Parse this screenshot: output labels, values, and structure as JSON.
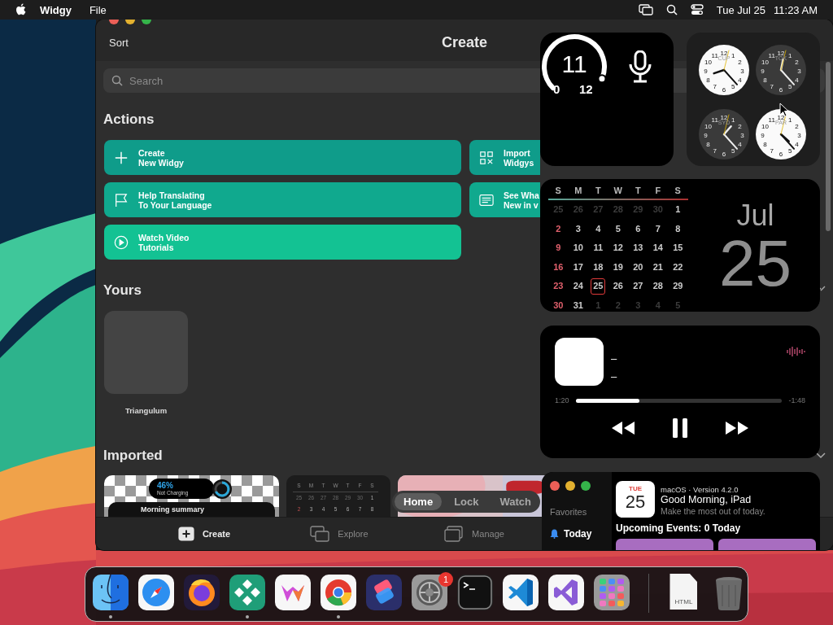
{
  "menu_bar": {
    "app": "Widgy",
    "menus": [
      "File"
    ],
    "date": "Tue Jul 25",
    "time": "11:23 AM"
  },
  "window": {
    "title": "Create",
    "sort_label": "Sort",
    "search": {
      "placeholder": "Search"
    }
  },
  "actions": {
    "heading": "Actions",
    "buttons": [
      {
        "lines": [
          "Create",
          "New Widgy"
        ]
      },
      {
        "lines": [
          "Import",
          "Widgys"
        ]
      },
      {
        "lines": [
          "Help Translating",
          "To Your Language"
        ]
      },
      {
        "lines": [
          "See Wha",
          "New in v"
        ]
      },
      {
        "lines": [
          "Watch Video",
          "Tutorials"
        ]
      }
    ]
  },
  "yours": {
    "heading": "Yours",
    "items": [
      {
        "name": "Triangulum"
      }
    ]
  },
  "imported": {
    "heading": "Imported",
    "items": [
      {
        "kind": "battery",
        "percent": "46%",
        "status": "Not Charging",
        "caption": "Morning summary"
      },
      {
        "kind": "calendar",
        "weekdays": [
          "S",
          "M",
          "T",
          "W",
          "T",
          "F",
          "S"
        ],
        "rows": [
          [
            "25",
            "26",
            "27",
            "28",
            "29",
            "30",
            "1"
          ],
          [
            "2",
            "3",
            "4",
            "5",
            "6",
            "7",
            "8"
          ]
        ]
      },
      {
        "kind": "picture"
      }
    ]
  },
  "view_switch": [
    {
      "label": "Home",
      "selected": true
    },
    {
      "label": "Lock",
      "selected": false
    },
    {
      "label": "Watch",
      "selected": false
    }
  ],
  "tab_bar": [
    {
      "label": "Create",
      "selected": true
    },
    {
      "label": "Explore",
      "selected": false
    },
    {
      "label": "Manage",
      "selected": false
    }
  ],
  "gauge_widget": {
    "value": "11",
    "min": "0",
    "max": "12"
  },
  "world_clock": {
    "clocks": [
      {
        "city": "CUP",
        "kind": "light",
        "numerals": [
          "12",
          "11",
          "1",
          "10",
          "2",
          "9",
          "3",
          "8",
          "4",
          "7",
          "5",
          "6"
        ]
      },
      {
        "city": "TOK",
        "kind": "dark",
        "numerals": [
          "12",
          "11",
          "1",
          "10",
          "2",
          "9",
          "3",
          "8",
          "4",
          "7",
          "5",
          "6"
        ]
      },
      {
        "city": "SYD",
        "kind": "dark",
        "numerals": [
          "12",
          "11",
          "1",
          "10",
          "2",
          "9",
          "3",
          "8",
          "4",
          "7",
          "5",
          "6"
        ]
      },
      {
        "city": "PAR",
        "kind": "light",
        "numerals": [
          "12",
          "11",
          "1",
          "10",
          "2",
          "9",
          "3",
          "8",
          "4",
          "7",
          "5",
          "6"
        ]
      }
    ]
  },
  "calendar_widget": {
    "weekdays": [
      "S",
      "M",
      "T",
      "W",
      "T",
      "F",
      "S"
    ],
    "month": "Jul",
    "day": "25",
    "weeks": [
      [
        {
          "d": "25",
          "in_month": false,
          "today": false
        },
        {
          "d": "26",
          "in_month": false,
          "today": false
        },
        {
          "d": "27",
          "in_month": false,
          "today": false
        },
        {
          "d": "28",
          "in_month": false,
          "today": false
        },
        {
          "d": "29",
          "in_month": false,
          "today": false
        },
        {
          "d": "30",
          "in_month": false,
          "today": false
        },
        {
          "d": "1",
          "in_month": true,
          "today": false
        }
      ],
      [
        {
          "d": "2",
          "in_month": true,
          "today": false
        },
        {
          "d": "3",
          "in_month": true,
          "today": false
        },
        {
          "d": "4",
          "in_month": true,
          "today": false
        },
        {
          "d": "5",
          "in_month": true,
          "today": false
        },
        {
          "d": "6",
          "in_month": true,
          "today": false
        },
        {
          "d": "7",
          "in_month": true,
          "today": false
        },
        {
          "d": "8",
          "in_month": true,
          "today": false
        }
      ],
      [
        {
          "d": "9",
          "in_month": true,
          "today": false
        },
        {
          "d": "10",
          "in_month": true,
          "today": false
        },
        {
          "d": "11",
          "in_month": true,
          "today": false
        },
        {
          "d": "12",
          "in_month": true,
          "today": false
        },
        {
          "d": "13",
          "in_month": true,
          "today": false
        },
        {
          "d": "14",
          "in_month": true,
          "today": false
        },
        {
          "d": "15",
          "in_month": true,
          "today": false
        }
      ],
      [
        {
          "d": "16",
          "in_month": true,
          "today": false
        },
        {
          "d": "17",
          "in_month": true,
          "today": false
        },
        {
          "d": "18",
          "in_month": true,
          "today": false
        },
        {
          "d": "19",
          "in_month": true,
          "today": false
        },
        {
          "d": "20",
          "in_month": true,
          "today": false
        },
        {
          "d": "21",
          "in_month": true,
          "today": false
        },
        {
          "d": "22",
          "in_month": true,
          "today": false
        }
      ],
      [
        {
          "d": "23",
          "in_month": true,
          "today": false
        },
        {
          "d": "24",
          "in_month": true,
          "today": false
        },
        {
          "d": "25",
          "in_month": true,
          "today": true
        },
        {
          "d": "26",
          "in_month": true,
          "today": false
        },
        {
          "d": "27",
          "in_month": true,
          "today": false
        },
        {
          "d": "28",
          "in_month": true,
          "today": false
        },
        {
          "d": "29",
          "in_month": true,
          "today": false
        }
      ],
      [
        {
          "d": "30",
          "in_month": true,
          "today": false
        },
        {
          "d": "31",
          "in_month": true,
          "today": false
        },
        {
          "d": "1",
          "in_month": false,
          "today": false
        },
        {
          "d": "2",
          "in_month": false,
          "today": false
        },
        {
          "d": "3",
          "in_month": false,
          "today": false
        },
        {
          "d": "4",
          "in_month": false,
          "today": false
        },
        {
          "d": "5",
          "in_month": false,
          "today": false
        }
      ]
    ]
  },
  "music_widget": {
    "title": "–",
    "artist": "–",
    "elapsed": "1:20",
    "remaining": "-1:48",
    "level": 0.31,
    "playing": true
  },
  "today_window": {
    "sidebar_heading": "Favorites",
    "sidebar_items": [
      {
        "label": "Today",
        "selected": true
      }
    ],
    "date_tile": {
      "weekday": "TUE",
      "day": "25"
    },
    "subtitle": "macOS · Version 4.2.0",
    "greeting": "Good Morning, iPad",
    "tagline": "Make the most out of today.",
    "events_heading": "Upcoming Events: 0 Today"
  },
  "dock": {
    "apps": [
      {
        "kind": "finder",
        "running": true
      },
      {
        "kind": "safari",
        "running": false
      },
      {
        "kind": "firefox",
        "running": false
      },
      {
        "kind": "widgy",
        "running": true
      },
      {
        "kind": "w",
        "running": false
      },
      {
        "kind": "chrome",
        "running": true
      },
      {
        "kind": "shortcuts",
        "running": false
      },
      {
        "kind": "settings",
        "running": false,
        "badge": "1"
      },
      {
        "kind": "terminal",
        "running": false
      },
      {
        "kind": "vscode",
        "running": false
      },
      {
        "kind": "vstudio",
        "running": false
      },
      {
        "kind": "launchpad",
        "running": false
      }
    ],
    "documents": [
      {
        "kind": "html",
        "label": "HTML"
      },
      {
        "kind": "trash"
      }
    ]
  }
}
